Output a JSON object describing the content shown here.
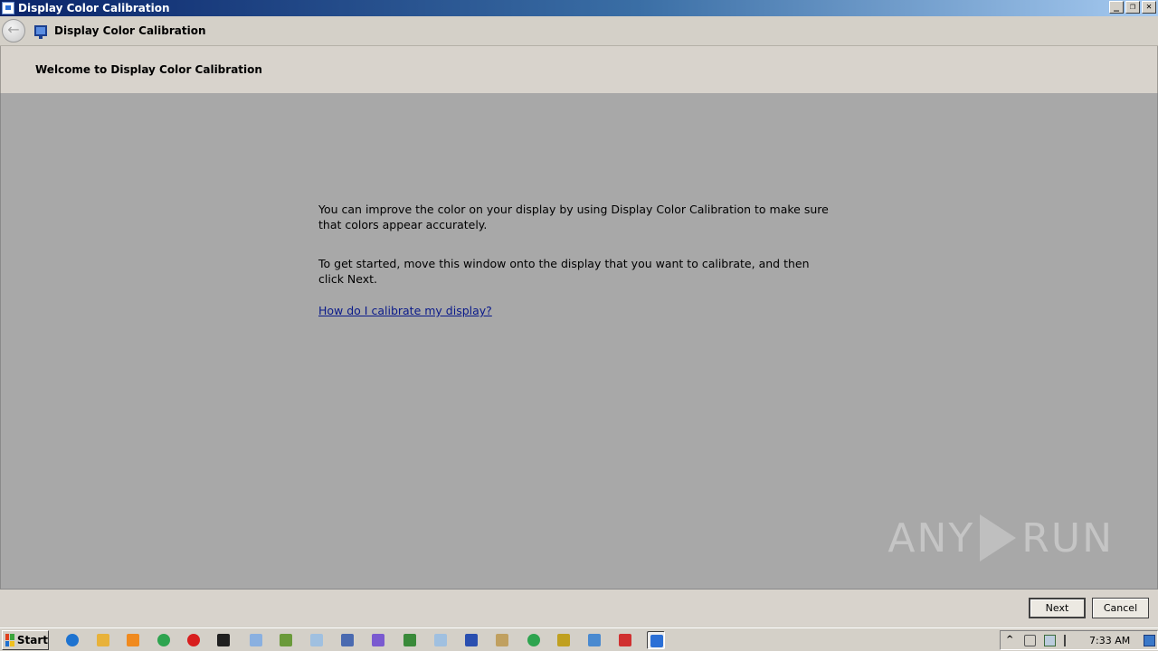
{
  "window": {
    "title": "Display Color Calibration",
    "buttons": {
      "minimize": "_",
      "restore": "❐",
      "close": "✕"
    }
  },
  "nav": {
    "title": "Display Color Calibration",
    "back_symbol": "←"
  },
  "header": {
    "title": "Welcome to Display Color Calibration"
  },
  "content": {
    "paragraph1": "You can improve the color on your display by using Display Color Calibration to make sure that colors appear accurately.",
    "paragraph2": "To get started, move this window onto the display that you want to calibrate, and then click Next.",
    "help_link": "How do I calibrate my display?"
  },
  "footer": {
    "next_label": "Next",
    "cancel_label": "Cancel"
  },
  "watermark": {
    "left": "ANY",
    "right": "RUN"
  },
  "taskbar": {
    "start_label": "Start",
    "icons": [
      "ie-icon",
      "folder-icon",
      "media-player-icon",
      "chrome-icon",
      "opera-icon",
      "cmd-icon",
      "notepad-icon",
      "app-icon",
      "window-icon",
      "help-icon",
      "paint-icon",
      "network-icon",
      "window-icon",
      "display-icon",
      "printer-icon",
      "chrome-icon",
      "search-icon",
      "remote-icon",
      "font-icon",
      "calibration-icon"
    ],
    "icon_colors": [
      "#1e73d0",
      "#e8b23a",
      "#f08a1e",
      "#2ea44f",
      "#d81e1e",
      "#202020",
      "#8ab0e0",
      "#6a9a3a",
      "#a0c0e0",
      "#4a6ab0",
      "#7a5ad0",
      "#3a8a3a",
      "#a0c0e0",
      "#2a4fb0",
      "#c0a060",
      "#2ea44f",
      "#c0a020",
      "#4a8ad0",
      "#d03030",
      "#2a6fd6"
    ],
    "active_icon_index": 19,
    "clock": "7:33 AM"
  }
}
